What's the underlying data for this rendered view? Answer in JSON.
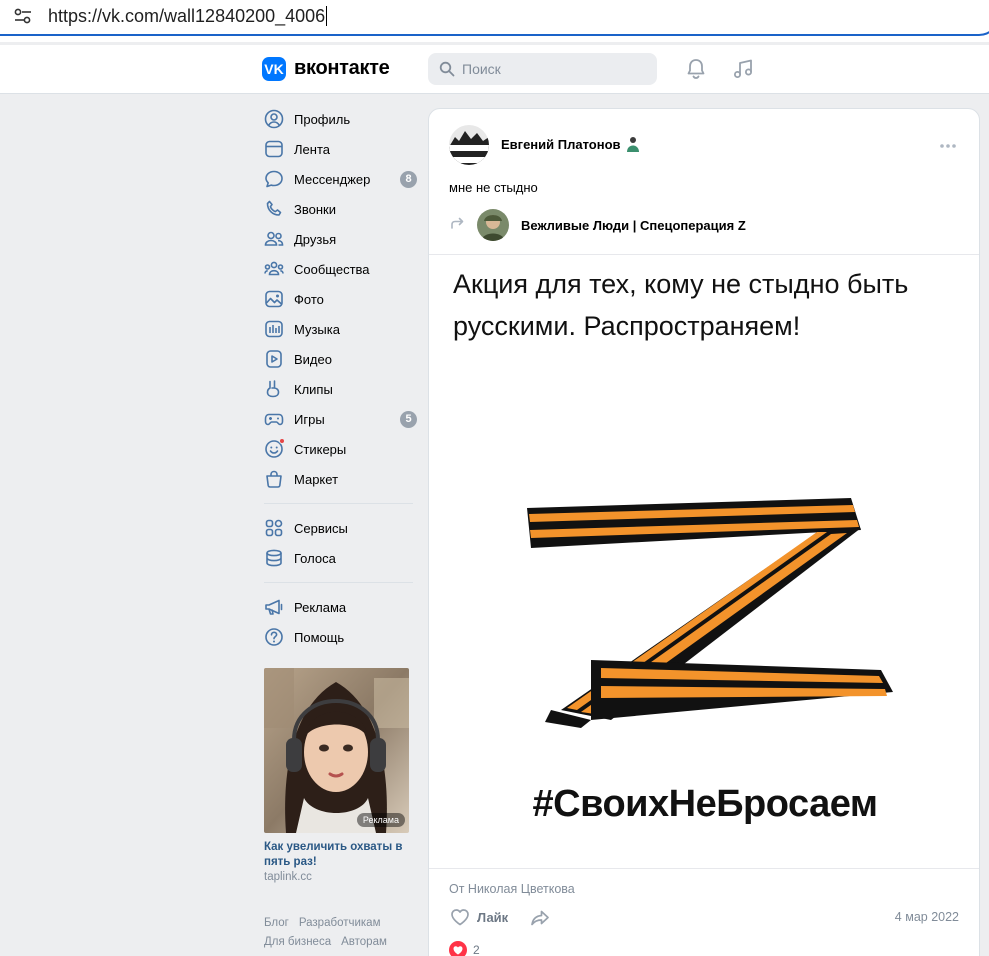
{
  "browser": {
    "url": "https://vk.com/wall12840200_4006"
  },
  "header": {
    "logo_text": "вконтакте",
    "search_placeholder": "Поиск",
    "brand_color": "#0077ff"
  },
  "nav": {
    "items": [
      {
        "label": "Профиль",
        "icon": "profile-icon"
      },
      {
        "label": "Лента",
        "icon": "feed-icon"
      },
      {
        "label": "Мессенджер",
        "icon": "messenger-icon",
        "badge": "8"
      },
      {
        "label": "Звонки",
        "icon": "phone-icon"
      },
      {
        "label": "Друзья",
        "icon": "friends-icon"
      },
      {
        "label": "Сообщества",
        "icon": "communities-icon"
      },
      {
        "label": "Фото",
        "icon": "photo-icon"
      },
      {
        "label": "Музыка",
        "icon": "music-icon"
      },
      {
        "label": "Видео",
        "icon": "video-icon"
      },
      {
        "label": "Клипы",
        "icon": "clips-icon"
      },
      {
        "label": "Игры",
        "icon": "games-icon",
        "badge": "5"
      },
      {
        "label": "Стикеры",
        "icon": "stickers-icon"
      },
      {
        "label": "Маркет",
        "icon": "market-icon"
      }
    ],
    "services": [
      {
        "label": "Сервисы",
        "icon": "services-icon"
      },
      {
        "label": "Голоса",
        "icon": "votes-icon"
      }
    ],
    "misc": [
      {
        "label": "Реклама",
        "icon": "ads-icon"
      },
      {
        "label": "Помощь",
        "icon": "help-icon"
      }
    ]
  },
  "ad": {
    "tag": "Реклама",
    "title": "Как увеличить охваты в пять раз!",
    "domain": "taplink.cc"
  },
  "footer": {
    "links": [
      "Блог",
      "Разработчикам",
      "Для бизнеса",
      "Авторам"
    ]
  },
  "post": {
    "author": "Евгений Платонов",
    "text": "мне не стыдно",
    "repost_source": "Вежливые Люди | Спецоперация Z",
    "image_caption": "Акция для тех, кому не стыдно быть русскими. Распространяем!",
    "image_hashtag": "#СвоихНеБросаем",
    "from_line": "От Николая Цветкова",
    "like_label": "Лайк",
    "date": "4 мар 2022",
    "reaction_count": "2"
  }
}
